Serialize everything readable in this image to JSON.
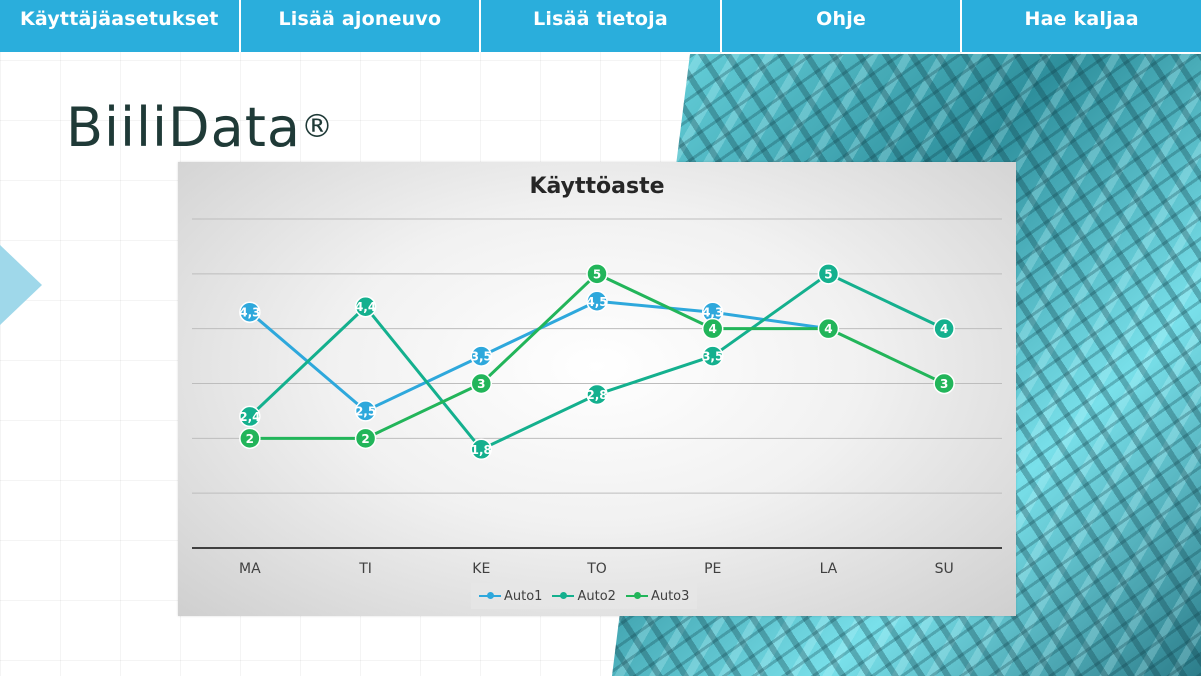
{
  "menu": {
    "items": [
      {
        "label": "Käyttäjäasetukset"
      },
      {
        "label": "Lisää ajoneuvo"
      },
      {
        "label": "Lisää tietoja"
      },
      {
        "label": "Ohje"
      },
      {
        "label": "Hae kaljaa"
      }
    ]
  },
  "brand": {
    "name": "BiiliData",
    "mark": "®"
  },
  "colors": {
    "menu_bg": "#2aaedc",
    "auto1": "#2ea8dc",
    "auto2": "#14b08e",
    "auto3": "#22b55a"
  },
  "chart_data": {
    "type": "line",
    "title": "Käyttöaste",
    "xlabel": "",
    "ylabel": "",
    "categories": [
      "MA",
      "TI",
      "KE",
      "TO",
      "PE",
      "LA",
      "SU"
    ],
    "ylim": [
      0,
      6
    ],
    "grid": true,
    "legend_position": "bottom",
    "series": [
      {
        "name": "Auto1",
        "color": "#2ea8dc",
        "values": [
          4.3,
          2.5,
          3.5,
          4.5,
          4.3,
          4,
          null
        ],
        "labels": [
          "4,3",
          "2,5",
          "3,5",
          "4,5",
          "4,3",
          "",
          ""
        ]
      },
      {
        "name": "Auto2",
        "color": "#14b08e",
        "values": [
          2.4,
          4.4,
          1.8,
          2.8,
          3.5,
          5,
          4
        ],
        "labels": [
          "2,4",
          "4,4",
          "1,8",
          "2,8",
          "3,5",
          "5",
          "4"
        ]
      },
      {
        "name": "Auto3",
        "color": "#22b55a",
        "values": [
          2,
          2,
          3,
          5,
          4,
          4,
          3
        ],
        "labels": [
          "2",
          "2",
          "3",
          "5",
          "4",
          "4",
          "3"
        ]
      }
    ]
  }
}
